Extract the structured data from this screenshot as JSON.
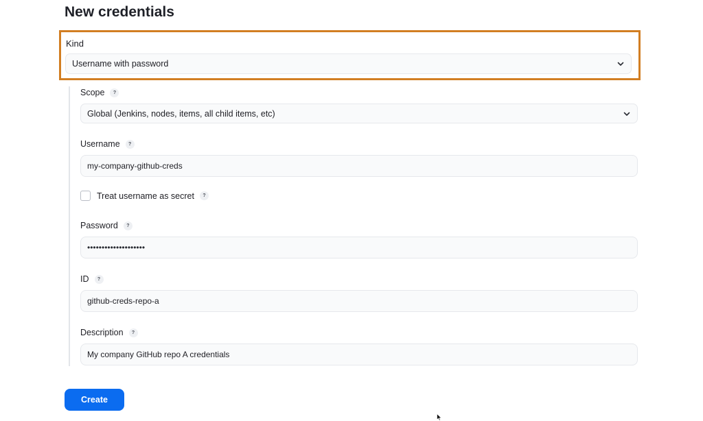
{
  "page": {
    "title": "New credentials"
  },
  "kind": {
    "label": "Kind",
    "value": "Username with password",
    "highlight_color": "#d27e22"
  },
  "scope": {
    "label": "Scope",
    "help": "?",
    "value": "Global (Jenkins, nodes, items, all child items, etc)"
  },
  "username": {
    "label": "Username",
    "help": "?",
    "value": "my-company-github-creds"
  },
  "treat_username_secret": {
    "label": "Treat username as secret",
    "help": "?",
    "checked": false
  },
  "password": {
    "label": "Password",
    "help": "?",
    "value": "••••••••••••••••••••"
  },
  "id": {
    "label": "ID",
    "help": "?",
    "value": "github-creds-repo-a"
  },
  "description": {
    "label": "Description",
    "help": "?",
    "value": "My company GitHub repo A credentials"
  },
  "actions": {
    "create_label": "Create",
    "create_color": "#0b6cf0"
  },
  "icons": {
    "dropdown": "chevron-down-icon",
    "cursor": "mouse-pointer-icon"
  }
}
